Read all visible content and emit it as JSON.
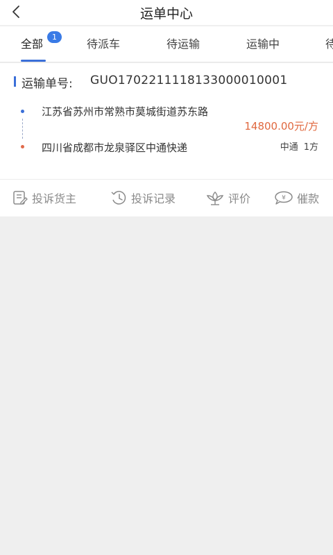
{
  "navbar": {
    "title": "运单中心",
    "back_icon": "chevron-left-icon"
  },
  "tabs": {
    "items": [
      {
        "label": "全部",
        "active": true,
        "badge": "1"
      },
      {
        "label": "待派车",
        "active": false
      },
      {
        "label": "待运输",
        "active": false
      },
      {
        "label": "运输中",
        "active": false
      },
      {
        "label": "待",
        "active": false
      }
    ],
    "accent_color": "#3a6fd8"
  },
  "order": {
    "number_label": "运输单号:",
    "number": "GUO170221111813300001000 1",
    "from_address": "江苏省苏州市常熟市莫城街道苏东路",
    "to_address": "四川省成都市龙泉驿区中通快递",
    "price": "14800.00元/方",
    "carrier": "中通",
    "quantity": "1方",
    "price_color": "#e0683f"
  },
  "actions": [
    {
      "label": "投诉货主",
      "icon": "edit-document-icon"
    },
    {
      "label": "投诉记录",
      "icon": "history-clock-icon"
    },
    {
      "label": "评价",
      "icon": "flower-rating-icon"
    },
    {
      "label": "催款",
      "icon": "payment-bubble-icon"
    }
  ]
}
